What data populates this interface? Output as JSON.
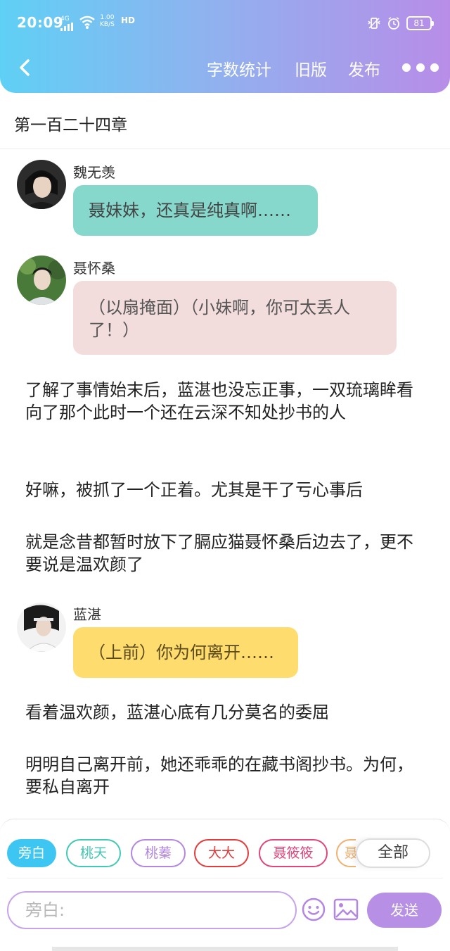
{
  "status": {
    "time": "20:09",
    "network": "4G",
    "speed_value": "1.00",
    "speed_unit": "KB/S",
    "hd": "HD",
    "battery": "81"
  },
  "nav": {
    "word_count": "字数统计",
    "old_version": "旧版",
    "publish": "发布"
  },
  "chapter_title": "第一百二十四章",
  "messages": [
    {
      "speaker": "魏无羡",
      "text": "聂妹妹，还真是纯真啊……",
      "bubble_color": "#86d8cc"
    },
    {
      "speaker": "聂怀桑",
      "text": "（以扇掩面）（小妹啊，你可太丢人了！）",
      "bubble_color": "#f2dcdc"
    },
    {
      "speaker": "蓝湛",
      "text": "（上前）你为何离开……",
      "bubble_color": "#fedd6e"
    }
  ],
  "narration": [
    "了解了事情始末后，蓝湛也没忘正事，一双琉璃眸看向了那个此时一个还在云深不知处抄书的人",
    "好嘛，被抓了一个正着。尤其是干了亏心事后",
    "就是念昔都暂时放下了膈应猫聂怀桑后边去了，更不要说是温欢颜了",
    "看着温欢颜，蓝湛心底有几分莫名的委屈",
    "明明自己离开前，她还乖乖的在藏书阁抄书。为何，要私自离开"
  ],
  "chips": [
    {
      "label": "旁白",
      "color": "#3ec6f2"
    },
    {
      "label": "桃天",
      "color": "#42c8b4"
    },
    {
      "label": "桃蓁",
      "color": "#b386e0"
    },
    {
      "label": "大大",
      "color": "#e23b3b"
    },
    {
      "label": "聂筱筱",
      "color": "#e0467a"
    },
    {
      "label": "聂",
      "color": "#f0b070"
    }
  ],
  "all_label": "全部",
  "input_placeholder": "旁白:",
  "send_label": "发送"
}
